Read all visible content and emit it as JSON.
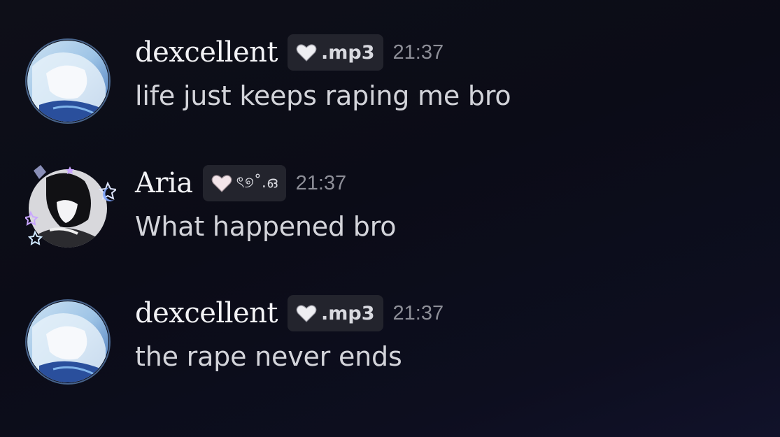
{
  "messages": [
    {
      "username": "dexcellent",
      "tag": ".mp3",
      "tag_icon": "heart-icon",
      "time": "21:37",
      "text": "life just keeps raping me bro",
      "avatar": "anime-avatar-blue"
    },
    {
      "username": "Aria",
      "tag": "ৎ୭˚.ഒ",
      "tag_icon": "heart-icon",
      "time": "21:37",
      "text": "What happened bro",
      "avatar": "anime-avatar-bw-stars"
    },
    {
      "username": "dexcellent",
      "tag": ".mp3",
      "tag_icon": "heart-icon",
      "time": "21:37",
      "text": "the rape never ends",
      "avatar": "anime-avatar-blue"
    }
  ],
  "colors": {
    "background": "#0d0e18",
    "username": "#f2f2f5",
    "message_text": "#d3d4da",
    "timestamp": "#8d8e97",
    "tag_background": "#23242d",
    "heart": "#f1e6ea"
  }
}
